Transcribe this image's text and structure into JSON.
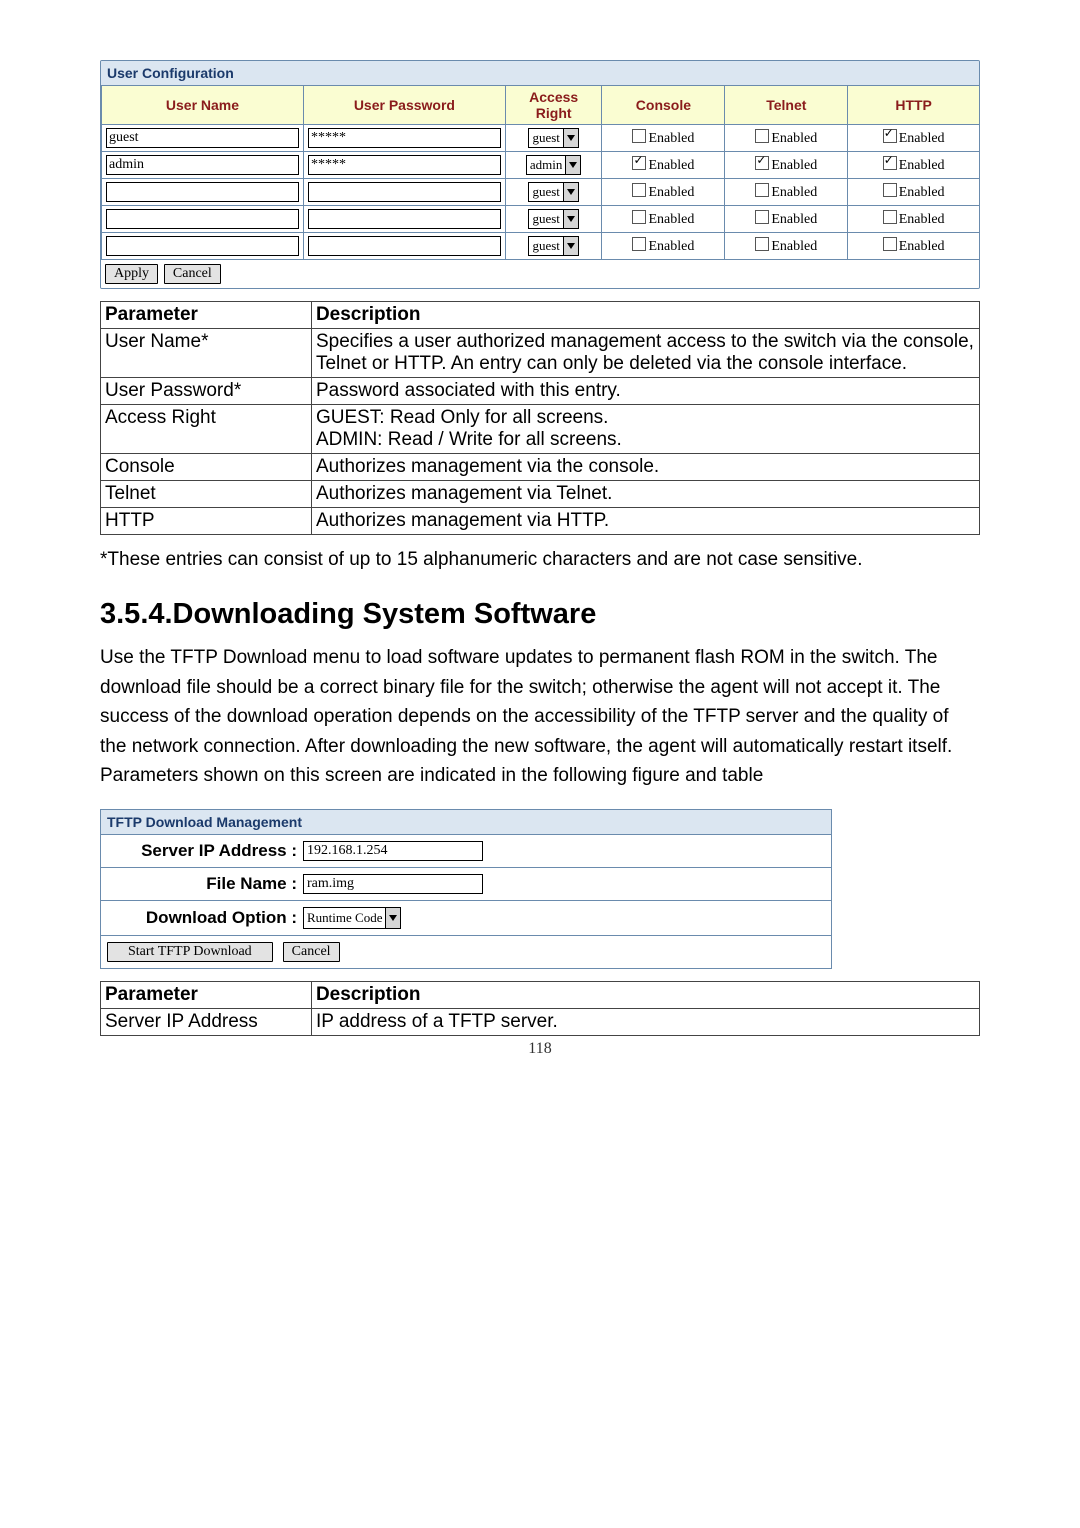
{
  "user_config": {
    "title": "User Configuration",
    "headers": {
      "name": "User Name",
      "password": "User Password",
      "access": "Access Right",
      "console": "Console",
      "telnet": "Telnet",
      "http": "HTTP"
    },
    "rows": [
      {
        "name": "guest",
        "password": "*****",
        "access": "guest",
        "console": false,
        "telnet": false,
        "http": true
      },
      {
        "name": "admin",
        "password": "*****",
        "access": "admin",
        "console": true,
        "telnet": true,
        "http": true
      },
      {
        "name": "",
        "password": "",
        "access": "guest",
        "console": false,
        "telnet": false,
        "http": false
      },
      {
        "name": "",
        "password": "",
        "access": "guest",
        "console": false,
        "telnet": false,
        "http": false
      },
      {
        "name": "",
        "password": "",
        "access": "guest",
        "console": false,
        "telnet": false,
        "http": false
      }
    ],
    "enabled_label": "Enabled",
    "apply": "Apply",
    "cancel": "Cancel"
  },
  "pd1": {
    "hdr_param": "Parameter",
    "hdr_desc": "Description",
    "rows": [
      {
        "p": "User Name*",
        "d": "Specifies a user authorized management access to the switch via the console, Telnet or HTTP. An entry can only be deleted via the console interface."
      },
      {
        "p": "User Password*",
        "d": "Password associated with this entry."
      },
      {
        "p": "Access Right",
        "d": "GUEST: Read Only for all screens.\nADMIN: Read / Write for all screens."
      },
      {
        "p": "Console",
        "d": "Authorizes management via the console."
      },
      {
        "p": "Telnet",
        "d": "Authorizes management via Telnet."
      },
      {
        "p": "HTTP",
        "d": "Authorizes management via HTTP."
      }
    ],
    "foot": "*These entries can consist of up to 15 alphanumeric characters and are not case sensitive."
  },
  "section": {
    "heading": "3.5.4.Downloading System Software",
    "body": "Use the TFTP Download menu to load software updates to permanent flash ROM in the switch. The download file should be a correct binary file for the switch; otherwise the agent will not accept it. The success of the download operation depends on the accessibility of the TFTP server and the quality of the network connection. After downloading the new software, the agent will automatically restart itself. Parameters shown on this screen are indicated in the following figure and table"
  },
  "tftp": {
    "title": "TFTP Download Management",
    "lbl_ip": "Server IP Address :",
    "ip": "192.168.1.254",
    "lbl_file": "File Name :",
    "file": "ram.img",
    "lbl_opt": "Download Option :",
    "opt": "Runtime Code",
    "start": "Start TFTP Download",
    "cancel": "Cancel"
  },
  "pd2": {
    "hdr_param": "Parameter",
    "hdr_desc": "Description",
    "rows": [
      {
        "p": "Server IP Address",
        "d": "IP address of a TFTP server."
      }
    ]
  },
  "page_number": "118"
}
